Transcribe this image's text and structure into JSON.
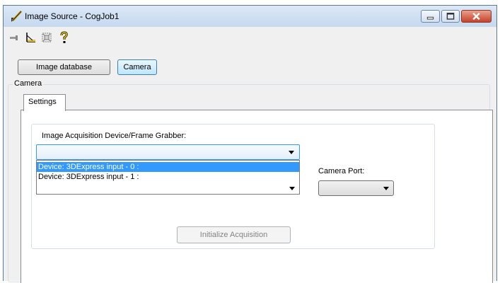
{
  "window": {
    "title": "Image Source - CogJob1"
  },
  "window_controls": {
    "minimize": "minimize-icon",
    "maximize": "maximize-icon",
    "close": "close-icon"
  },
  "toolbar": {
    "icons": [
      "pin-icon",
      "measure-tool-icon",
      "region-tool-icon",
      "help-icon"
    ]
  },
  "source_buttons": {
    "image_database": "Image database",
    "camera": "Camera"
  },
  "camera_group": {
    "label": "Camera",
    "tab": "Settings",
    "device_label": "Image Acquisition Device/Frame Grabber:",
    "device_value": "",
    "device_options": [
      "Device: 3DExpress input - 0 :",
      "Device: 3DExpress input - 1 :"
    ],
    "camera_port_label": "Camera Port:",
    "camera_port_value": "",
    "initialize_button": "Initialize Acquisition"
  },
  "colors": {
    "selection": "#3399ff",
    "title_gradient_top": "#dbe8f6",
    "close_button": "#c7422a"
  }
}
